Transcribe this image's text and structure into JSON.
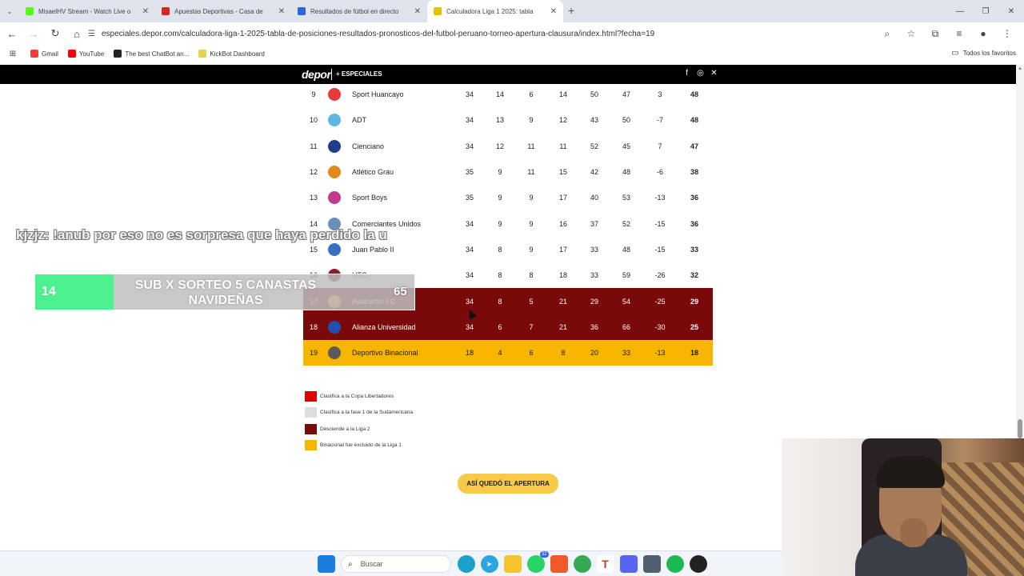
{
  "browser": {
    "tabs": [
      {
        "title": "MisaelHV Stream - Watch Live o",
        "color": "#53fc18"
      },
      {
        "title": "Apuestas Deportivas - Casa de",
        "color": "#d7261e"
      },
      {
        "title": "Resultados de fútbol en directo",
        "color": "#2f66d6"
      },
      {
        "title": "Calculadora Liga 1 2025: tabla",
        "color": "#e3c300"
      }
    ],
    "url": "especiales.depor.com/calculadora-liga-1-2025-tabla-de-posiciones-resultados-pronosticos-del-futbol-peruano-torneo-apertura-clausura/index.html?fecha=19",
    "bookmarks": [
      "Gmail",
      "YouTube",
      "The best ChatBot an...",
      "KickBot Dashboard"
    ],
    "bookmarks_all": "Todos los favoritos"
  },
  "site": {
    "logo": "depor",
    "section": "+ ESPECIALES",
    "social_icons": [
      "facebook-icon",
      "whatsapp-icon",
      "x-icon"
    ]
  },
  "standings": {
    "rows": [
      {
        "pos": "9",
        "team": "Sport Huancayo",
        "pj": "34",
        "g": "14",
        "e": "6",
        "p": "14",
        "gf": "50",
        "gc": "47",
        "dg": "3",
        "pts": "48",
        "zone": "none",
        "crest": "#e43a3a"
      },
      {
        "pos": "10",
        "team": "ADT",
        "pj": "34",
        "g": "13",
        "e": "9",
        "p": "12",
        "gf": "43",
        "gc": "50",
        "dg": "-7",
        "pts": "48",
        "zone": "none",
        "crest": "#5fb7e0"
      },
      {
        "pos": "11",
        "team": "Cienciano",
        "pj": "34",
        "g": "12",
        "e": "11",
        "p": "11",
        "gf": "52",
        "gc": "45",
        "dg": "7",
        "pts": "47",
        "zone": "none",
        "crest": "#1d3c8a"
      },
      {
        "pos": "12",
        "team": "Atlético Grau",
        "pj": "35",
        "g": "9",
        "e": "11",
        "p": "15",
        "gf": "42",
        "gc": "48",
        "dg": "-6",
        "pts": "38",
        "zone": "none",
        "crest": "#e38a1a"
      },
      {
        "pos": "13",
        "team": "Sport Boys",
        "pj": "35",
        "g": "9",
        "e": "9",
        "p": "17",
        "gf": "40",
        "gc": "53",
        "dg": "-13",
        "pts": "36",
        "zone": "none",
        "crest": "#c23a8c"
      },
      {
        "pos": "14",
        "team": "Comerciantes Unidos",
        "pj": "34",
        "g": "9",
        "e": "9",
        "p": "16",
        "gf": "37",
        "gc": "52",
        "dg": "-15",
        "pts": "36",
        "zone": "none",
        "crest": "#6a8fb8"
      },
      {
        "pos": "15",
        "team": "Juan Pablo II",
        "pj": "34",
        "g": "8",
        "e": "9",
        "p": "17",
        "gf": "33",
        "gc": "48",
        "dg": "-15",
        "pts": "33",
        "zone": "none",
        "crest": "#3a6fbf"
      },
      {
        "pos": "16",
        "team": "UTC",
        "pj": "34",
        "g": "8",
        "e": "8",
        "p": "18",
        "gf": "33",
        "gc": "59",
        "dg": "-26",
        "pts": "32",
        "zone": "none",
        "crest": "#8a1e2a"
      },
      {
        "pos": "17",
        "team": "Ayacucho FC",
        "pj": "34",
        "g": "8",
        "e": "5",
        "p": "21",
        "gf": "29",
        "gc": "54",
        "dg": "-25",
        "pts": "29",
        "zone": "rel",
        "crest": "#d98e2a"
      },
      {
        "pos": "18",
        "team": "Alianza Universidad",
        "pj": "34",
        "g": "6",
        "e": "7",
        "p": "21",
        "gf": "36",
        "gc": "66",
        "dg": "-30",
        "pts": "25",
        "zone": "rel",
        "crest": "#1f4fb0"
      },
      {
        "pos": "19",
        "team": "Deportivo Binacional",
        "pj": "18",
        "g": "4",
        "e": "6",
        "p": "8",
        "gf": "20",
        "gc": "33",
        "dg": "-13",
        "pts": "18",
        "zone": "excl",
        "crest": "#5a5a5a"
      }
    ]
  },
  "legend": [
    {
      "color": "#e00000",
      "label": "Clasifica a la Copa Libertadores"
    },
    {
      "color": "#dddddd",
      "label": "Clasifica a la fase 1 de la Sudamericana"
    },
    {
      "color": "#7a0a0a",
      "label": "Desciende a la Liga 2"
    },
    {
      "color": "#f7b500",
      "label": "Binacional fue excluido de la Liga 1"
    }
  ],
  "cta": "ASÍ QUEDÓ EL APERTURA",
  "overlay": {
    "chat": "kjzjz: !anub por eso no es sorpresa que haya perdido la u",
    "promo_number": "14",
    "promo_text": "SUB X SORTEO 5 CANASTAS NAVIDEÑAS",
    "promo_number_right": "65"
  },
  "taskbar": {
    "search_placeholder": "Buscar",
    "badge": "32"
  }
}
